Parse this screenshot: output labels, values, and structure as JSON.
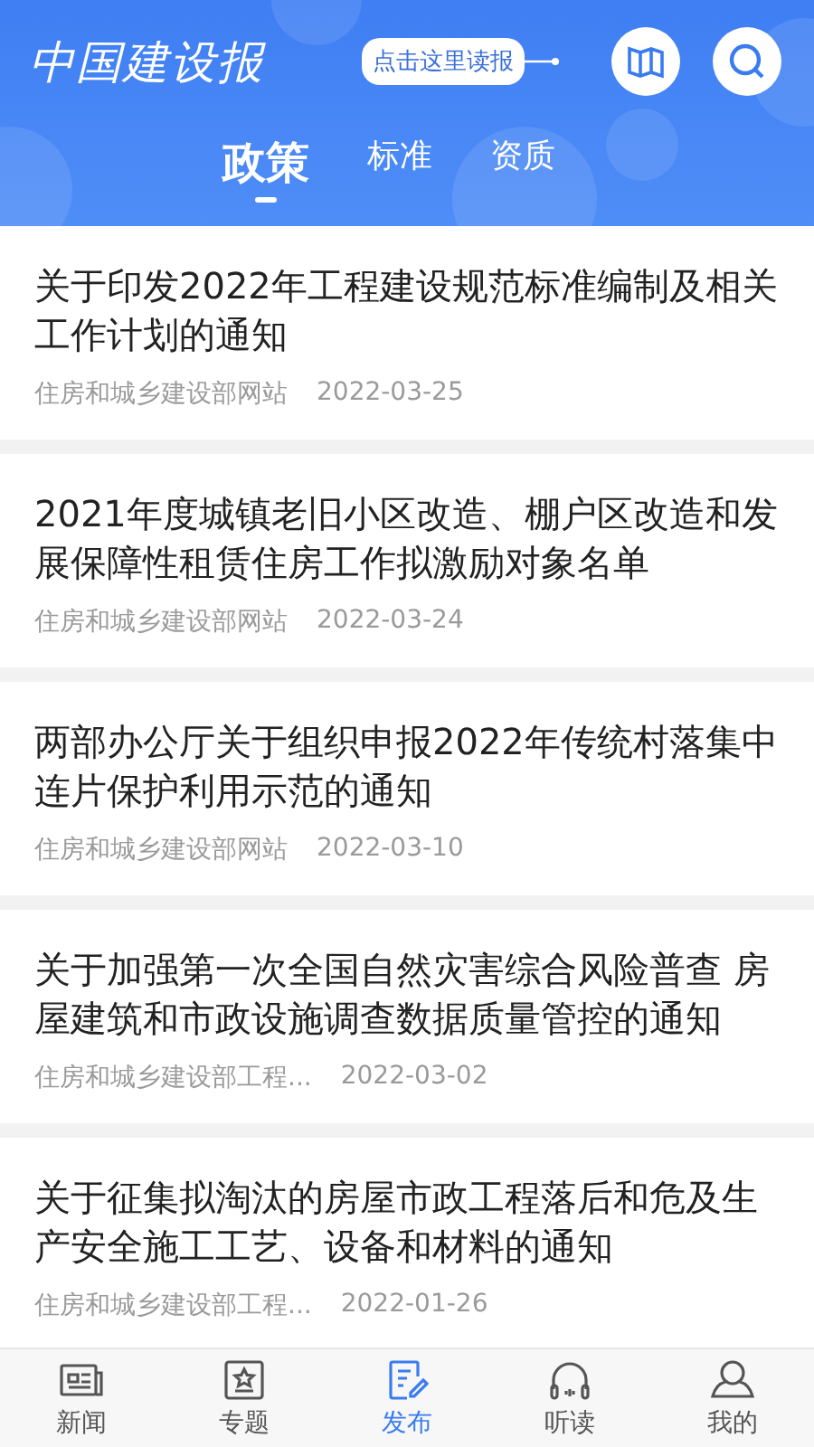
{
  "header": {
    "logo": "中国建设报",
    "read_paper": "点击这里读报"
  },
  "tabs": [
    {
      "label": "政策",
      "selected": true
    },
    {
      "label": "标准",
      "selected": false
    },
    {
      "label": "资质",
      "selected": false
    }
  ],
  "articles": [
    {
      "title": "关于印发2022年工程建设规范标准编制及相关工作计划的通知",
      "source": "住房和城乡建设部网站",
      "date": "2022-03-25"
    },
    {
      "title": "2021年度城镇老旧小区改造、棚户区改造和发展保障性租赁住房工作拟激励对象名单",
      "source": "住房和城乡建设部网站",
      "date": "2022-03-24"
    },
    {
      "title": "两部办公厅关于组织申报2022年传统村落集中连片保护利用示范的通知",
      "source": "住房和城乡建设部网站",
      "date": "2022-03-10"
    },
    {
      "title": "关于加强第一次全国自然灾害综合风险普查 房屋建筑和市政设施调查数据质量管控的通知",
      "source": "住房和城乡建设部工程...",
      "date": "2022-03-02"
    },
    {
      "title": "关于征集拟淘汰的房屋市政工程落后和危及生产安全施工工艺、设备和材料的通知",
      "source": "住房和城乡建设部工程...",
      "date": "2022-01-26"
    }
  ],
  "nav": [
    {
      "kind": "news",
      "label": "新闻",
      "selected": false
    },
    {
      "kind": "topic",
      "label": "专题",
      "selected": false
    },
    {
      "kind": "publish",
      "label": "发布",
      "selected": true
    },
    {
      "kind": "listen",
      "label": "听读",
      "selected": false
    },
    {
      "kind": "me",
      "label": "我的",
      "selected": false
    }
  ]
}
